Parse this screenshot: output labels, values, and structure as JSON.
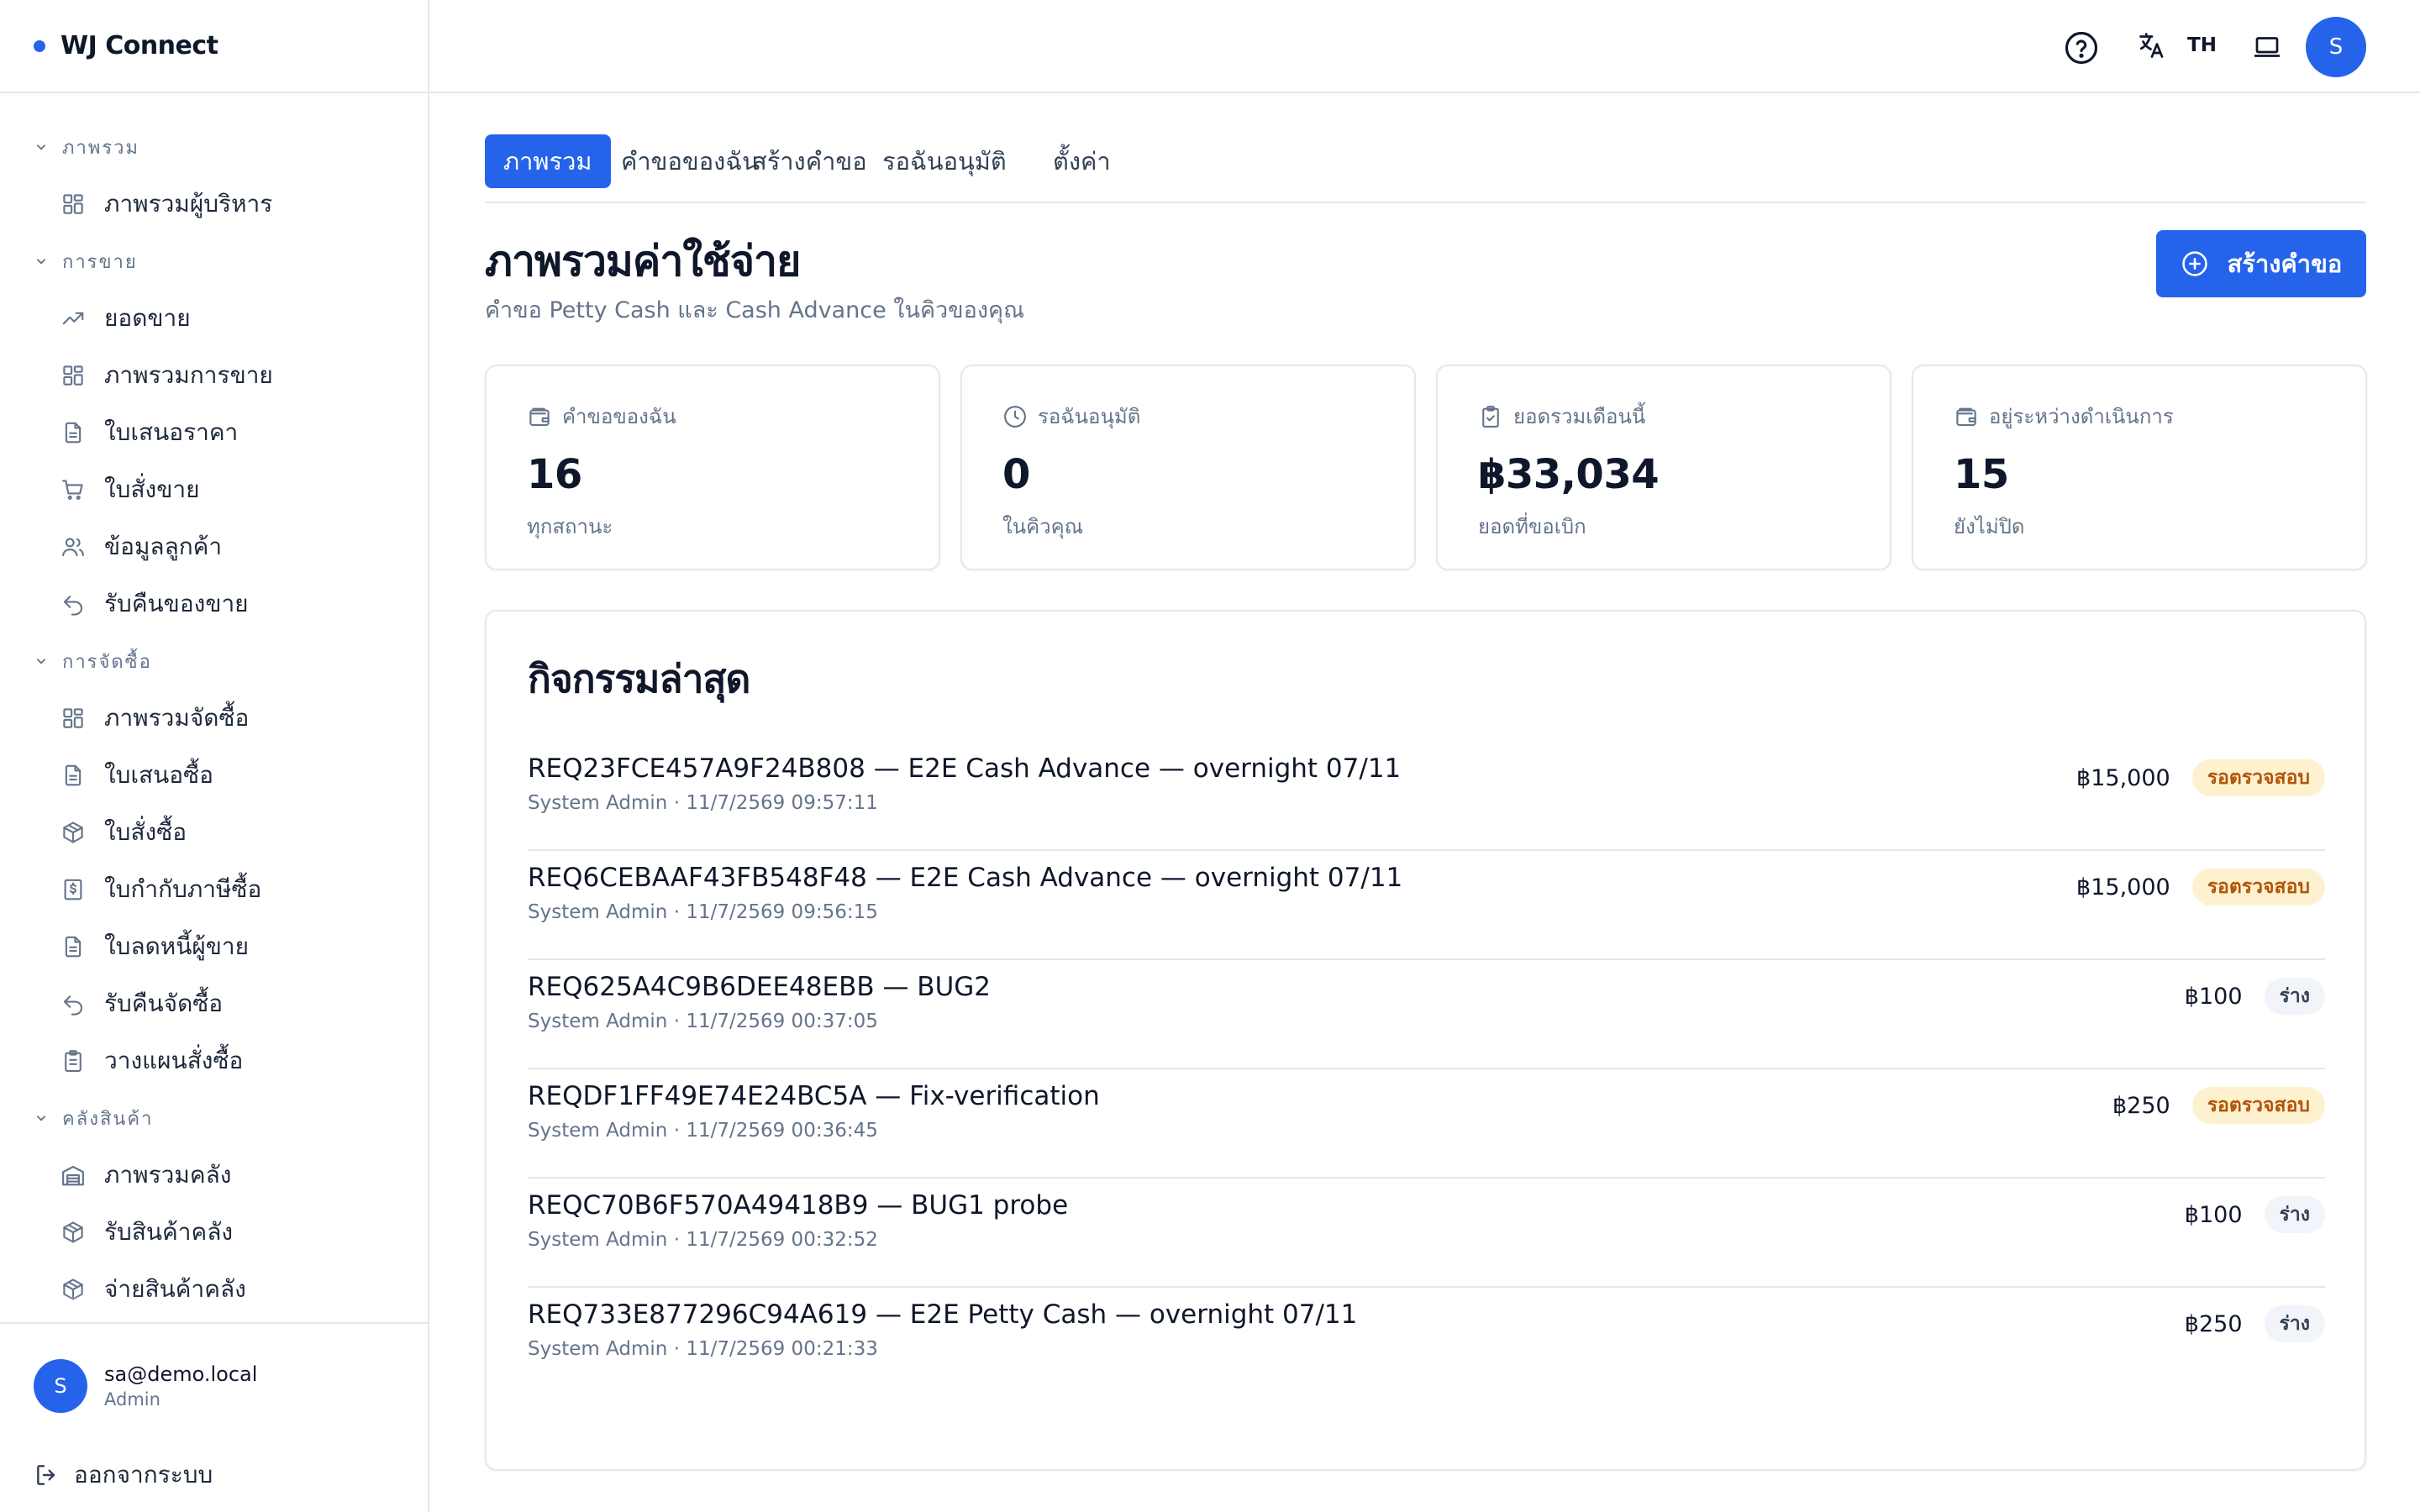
{
  "brand": {
    "name": "WJ Connect",
    "accent": "#2563eb"
  },
  "sidebar": {
    "groups": [
      {
        "label": "ภาพรวม",
        "items": [
          {
            "label": "ภาพรวมผู้บริหาร",
            "icon": "dashboard-icon"
          }
        ]
      },
      {
        "label": "การขาย",
        "items": [
          {
            "label": "ยอดขาย",
            "icon": "trending-up-icon"
          },
          {
            "label": "ภาพรวมการขาย",
            "icon": "dashboard-icon"
          },
          {
            "label": "ใบเสนอราคา",
            "icon": "document-icon"
          },
          {
            "label": "ใบสั่งขาย",
            "icon": "cart-icon"
          },
          {
            "label": "ข้อมูลลูกค้า",
            "icon": "users-icon"
          },
          {
            "label": "รับคืนของขาย",
            "icon": "undo-icon"
          }
        ]
      },
      {
        "label": "การจัดซื้อ",
        "items": [
          {
            "label": "ภาพรวมจัดซื้อ",
            "icon": "dashboard-icon"
          },
          {
            "label": "ใบเสนอซื้อ",
            "icon": "document-icon"
          },
          {
            "label": "ใบสั่งซื้อ",
            "icon": "package-icon"
          },
          {
            "label": "ใบกำกับภาษีซื้อ",
            "icon": "invoice-icon"
          },
          {
            "label": "ใบลดหนี้ผู้ขาย",
            "icon": "document-icon"
          },
          {
            "label": "รับคืนจัดซื้อ",
            "icon": "undo-icon"
          },
          {
            "label": "วางแผนสั่งซื้อ",
            "icon": "clipboard-icon"
          }
        ]
      },
      {
        "label": "คลังสินค้า",
        "items": [
          {
            "label": "ภาพรวมคลัง",
            "icon": "warehouse-icon"
          },
          {
            "label": "รับสินค้าคลัง",
            "icon": "package-icon"
          },
          {
            "label": "จ่ายสินค้าคลัง",
            "icon": "package-icon"
          }
        ]
      }
    ]
  },
  "user": {
    "initial": "S",
    "email": "sa@demo.local",
    "role": "Admin",
    "logout_label": "ออกจากระบบ"
  },
  "topbar": {
    "language": "TH",
    "avatar_initial": "S"
  },
  "tabs": [
    {
      "label": "ภาพรวม",
      "active": true
    },
    {
      "label": "คำขอของฉัน",
      "active": false
    },
    {
      "label": "สร้างคำขอ",
      "active": false
    },
    {
      "label": "รอฉันอนุมัติ",
      "active": false
    },
    {
      "label": "ตั้งค่า",
      "active": false
    }
  ],
  "page": {
    "title": "ภาพรวมค่าใช้จ่าย",
    "subtitle": "คำขอ Petty Cash และ Cash Advance ในคิวของคุณ",
    "create_label": "สร้างคำขอ"
  },
  "stats": [
    {
      "label": "คำขอของฉัน",
      "value": "16",
      "note": "ทุกสถานะ",
      "icon": "wallet-icon"
    },
    {
      "label": "รอฉันอนุมัติ",
      "value": "0",
      "note": "ในคิวคุณ",
      "icon": "clock-icon"
    },
    {
      "label": "ยอดรวมเดือนนี้",
      "value": "฿33,034",
      "note": "ยอดที่ขอเบิก",
      "icon": "clipboard-check-icon"
    },
    {
      "label": "อยู่ระหว่างดำเนินการ",
      "value": "15",
      "note": "ยังไม่ปิด",
      "icon": "wallet-icon"
    }
  ],
  "activity": {
    "title": "กิจกรรมล่าสุด",
    "rows": [
      {
        "name": "REQ23FCE457A9F24B808 — E2E Cash Advance — overnight 07/11",
        "meta": "System Admin · 11/7/2569 09:57:11",
        "amount": "฿15,000",
        "status": "รอตรวจสอบ",
        "kind": "review"
      },
      {
        "name": "REQ6CEBAAF43FB548F48 — E2E Cash Advance — overnight 07/11",
        "meta": "System Admin · 11/7/2569 09:56:15",
        "amount": "฿15,000",
        "status": "รอตรวจสอบ",
        "kind": "review"
      },
      {
        "name": "REQ625A4C9B6DEE48EBB — BUG2",
        "meta": "System Admin · 11/7/2569 00:37:05",
        "amount": "฿100",
        "status": "ร่าง",
        "kind": "draft"
      },
      {
        "name": "REQDF1FF49E74E24BC5A — Fix-verification",
        "meta": "System Admin · 11/7/2569 00:36:45",
        "amount": "฿250",
        "status": "รอตรวจสอบ",
        "kind": "review"
      },
      {
        "name": "REQC70B6F570A49418B9 — BUG1 probe",
        "meta": "System Admin · 11/7/2569 00:32:52",
        "amount": "฿100",
        "status": "ร่าง",
        "kind": "draft"
      },
      {
        "name": "REQ733E877296C94A619 — E2E Petty Cash — overnight 07/11",
        "meta": "System Admin · 11/7/2569 00:21:33",
        "amount": "฿250",
        "status": "ร่าง",
        "kind": "draft"
      }
    ]
  }
}
